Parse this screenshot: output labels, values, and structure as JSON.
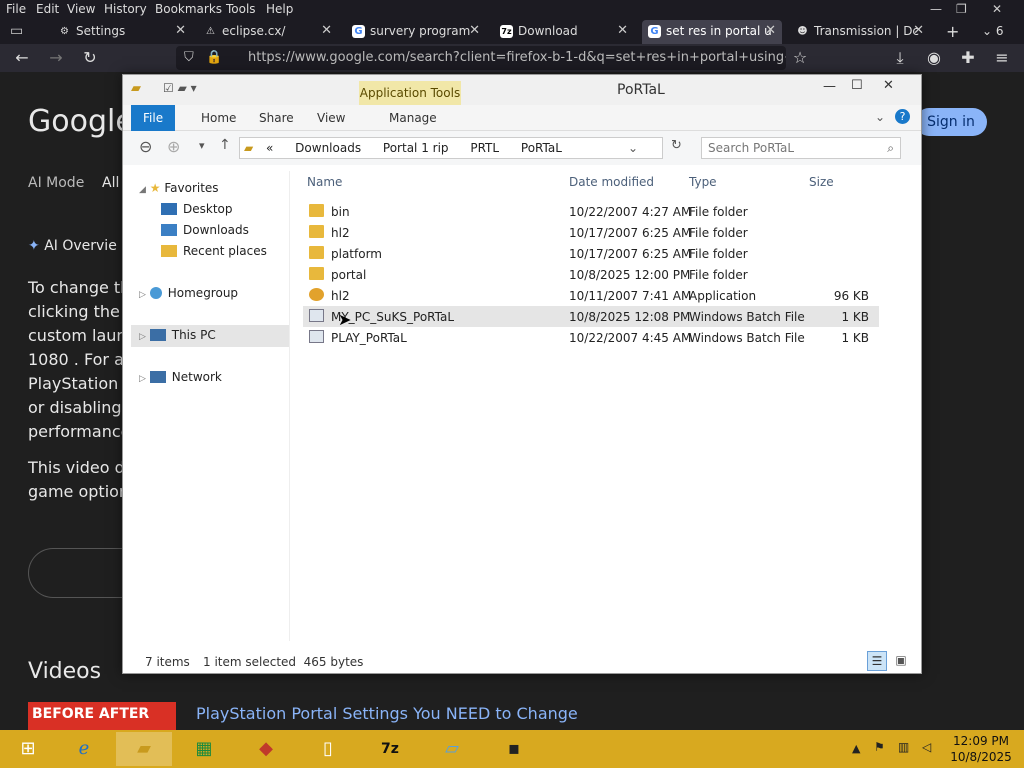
{
  "menu": [
    "File",
    "Edit",
    "View",
    "History",
    "Bookmarks",
    "Tools",
    "Help"
  ],
  "tabs": [
    {
      "label": "Settings",
      "icon": "gear-icon"
    },
    {
      "label": "eclipse.cx/",
      "icon": "warning-icon"
    },
    {
      "label": "survery program",
      "icon": "google-icon"
    },
    {
      "label": "Download",
      "icon": "7zip-icon"
    },
    {
      "label": "set res in portal u",
      "icon": "google-icon"
    },
    {
      "label": "Transmission | Dc",
      "icon": "transmission-icon"
    }
  ],
  "tab_count": "6",
  "url": "https://www.google.com/search?client=firefox-b-1-d&q=set+res+in+portal+using+ga",
  "google": {
    "logo": "Google",
    "sign_in": "Sign in",
    "ai_mode": "AI Mode",
    "all": "All",
    "ai_overview": "AI Overvie",
    "lines": [
      "To change the",
      "clicking the g",
      "custom launc",
      "1080 . For a l",
      "PlayStation 5",
      "or disabling 1",
      "performance."
    ],
    "line2": [
      "This video de",
      "game options"
    ],
    "videos_heading": "Videos",
    "video_title": "PlayStation Portal Settings You NEED to Change",
    "thumb_text": "BEFORE  AFTER"
  },
  "explorer": {
    "title": "PoRTaL",
    "app_tools": "Application Tools",
    "ribbon": [
      "File",
      "Home",
      "Share",
      "View",
      "Manage"
    ],
    "breadcrumb": [
      "«",
      "Downloads",
      "Portal 1 rip",
      "PRTL",
      "PoRTaL"
    ],
    "search_placeholder": "Search PoRTaL",
    "nav": {
      "favorites": "Favorites",
      "desktop": "Desktop",
      "downloads": "Downloads",
      "recent": "Recent places",
      "homegroup": "Homegroup",
      "thispc": "This PC",
      "network": "Network"
    },
    "columns": [
      "Name",
      "Date modified",
      "Type",
      "Size"
    ],
    "files": [
      {
        "name": "bin",
        "date": "10/22/2007 4:27 AM",
        "type": "File folder",
        "size": "",
        "kind": "folder"
      },
      {
        "name": "hl2",
        "date": "10/17/2007 6:25 AM",
        "type": "File folder",
        "size": "",
        "kind": "folder"
      },
      {
        "name": "platform",
        "date": "10/17/2007 6:25 AM",
        "type": "File folder",
        "size": "",
        "kind": "folder"
      },
      {
        "name": "portal",
        "date": "10/8/2025 12:00 PM",
        "type": "File folder",
        "size": "",
        "kind": "folder"
      },
      {
        "name": "hl2",
        "date": "10/11/2007 7:41 AM",
        "type": "Application",
        "size": "96 KB",
        "kind": "app"
      },
      {
        "name": "MY_PC_SuKS_PoRTaL",
        "date": "10/8/2025 12:08 PM",
        "type": "Windows Batch File",
        "size": "1 KB",
        "kind": "bat"
      },
      {
        "name": "PLAY_PoRTaL",
        "date": "10/22/2007 4:45 AM",
        "type": "Windows Batch File",
        "size": "1 KB",
        "kind": "bat"
      }
    ],
    "status_items": "7 items",
    "status_selected": "1 item selected  465 bytes"
  },
  "taskbar": {
    "time": "12:09 PM",
    "date": "10/8/2025"
  }
}
